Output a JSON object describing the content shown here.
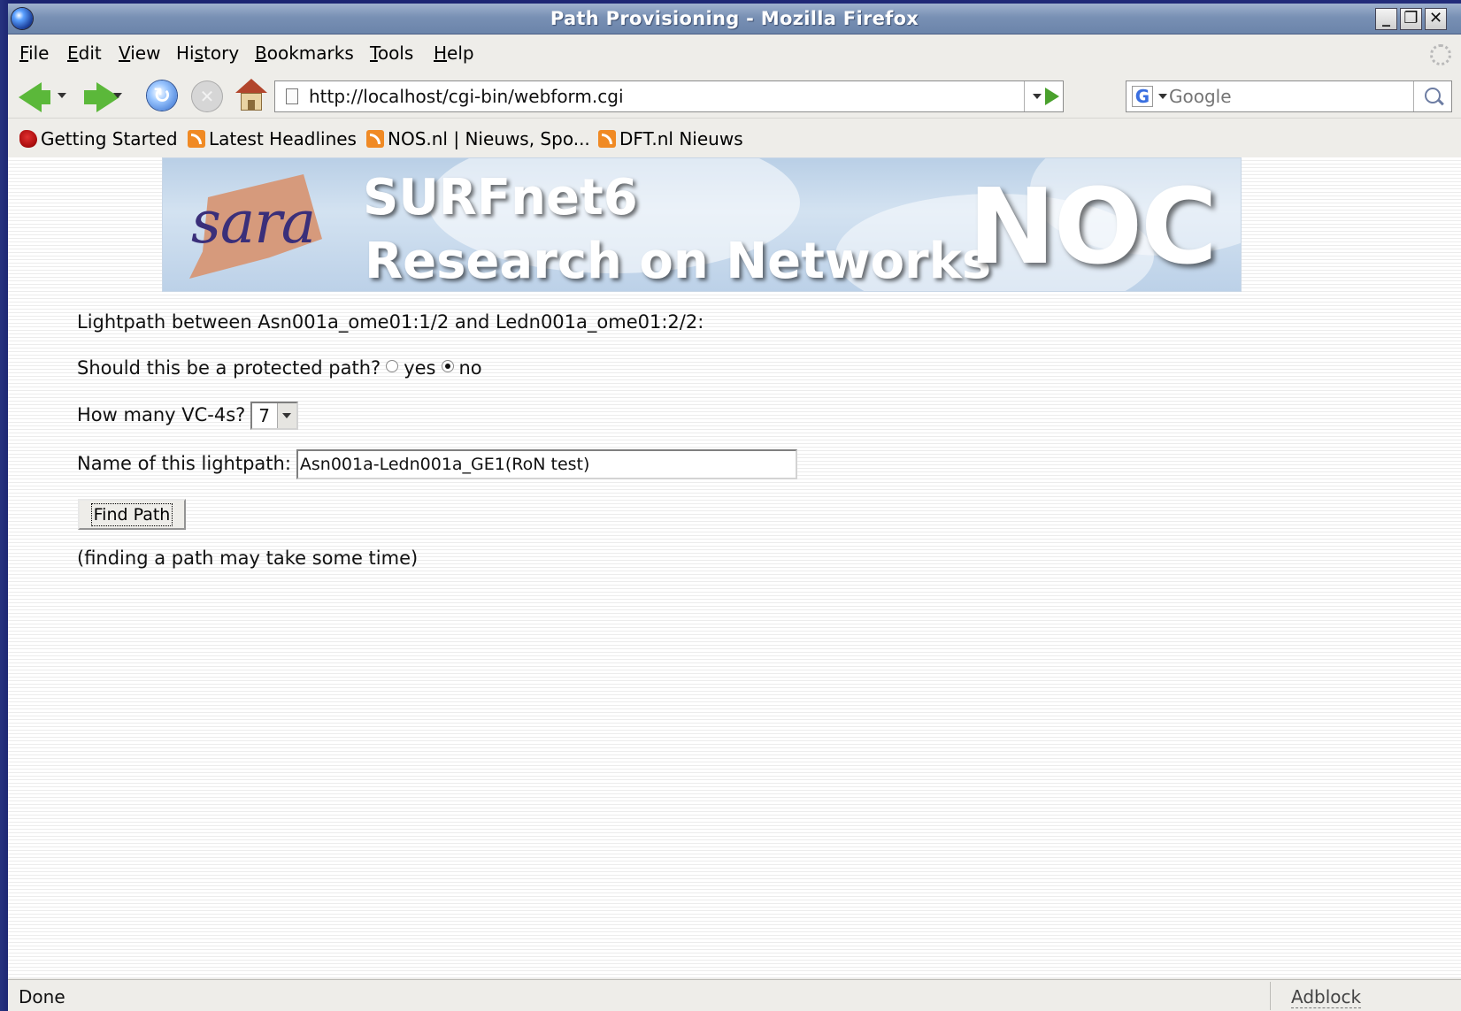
{
  "window": {
    "title": "Path Provisioning - Mozilla Firefox"
  },
  "menu": {
    "file": {
      "u": "F",
      "rest": "ile"
    },
    "edit": {
      "u": "E",
      "rest": "dit"
    },
    "view": {
      "u": "V",
      "rest": "iew"
    },
    "history": {
      "pre": "Hi",
      "u": "s",
      "rest": "tory"
    },
    "bookmarks": {
      "u": "B",
      "rest": "ookmarks"
    },
    "tools": {
      "u": "T",
      "rest": "ools"
    },
    "help": {
      "u": "H",
      "rest": "elp"
    }
  },
  "navigation": {
    "url": "http://localhost/cgi-bin/webform.cgi",
    "search_placeholder": "Google",
    "search_engine_letter": "G"
  },
  "bookmarks": [
    {
      "label": "Getting Started",
      "icon": "firefox-icon"
    },
    {
      "label": "Latest Headlines",
      "icon": "rss-icon"
    },
    {
      "label": "NOS.nl | Nieuws, Spo...",
      "icon": "rss-icon"
    },
    {
      "label": "DFT.nl Nieuws",
      "icon": "rss-icon"
    }
  ],
  "banner": {
    "logo_text": "sara",
    "line1": "SURFnet6",
    "line2": "Research on Networks",
    "noc": "NOC"
  },
  "form": {
    "lightpath_text": "Lightpath between Asn001a_ome01:1/2 and Ledn001a_ome01:2/2:",
    "protected_question": "Should this be a protected path?",
    "option_yes": "yes",
    "option_no": "no",
    "protected_selected": "no",
    "vc4_question": "How many VC-4s?",
    "vc4_value": "7",
    "name_label": "Name of this lightpath:",
    "name_value": "Asn001a-Ledn001a_GE1(RoN test)",
    "submit_label": "Find Path",
    "note": "(finding a path may take some time)"
  },
  "status": {
    "text": "Done",
    "adblock": "Adblock"
  }
}
